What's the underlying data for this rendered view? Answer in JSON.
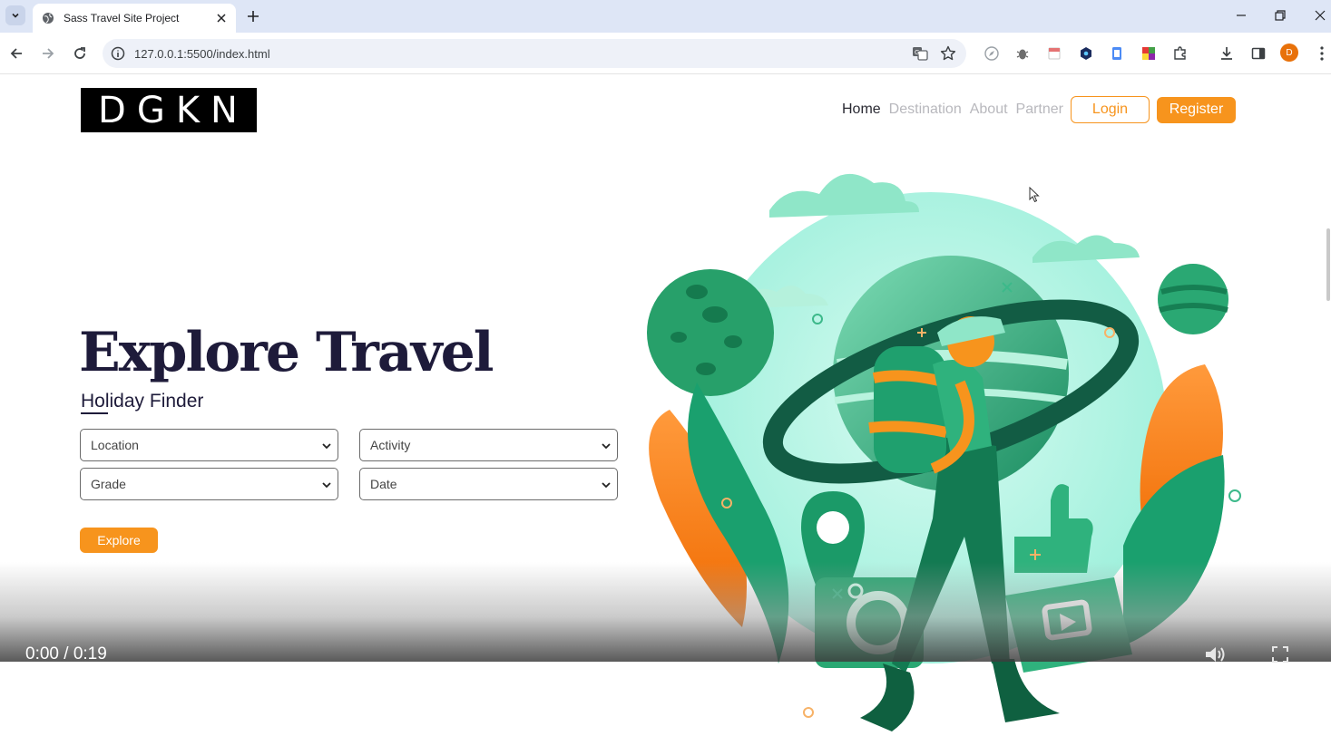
{
  "browser": {
    "tab_title": "Sass Travel Site Project",
    "url": "127.0.0.1:5500/index.html",
    "profile_initial": "D"
  },
  "brand": {
    "logo_text": "DGKN"
  },
  "nav": {
    "links": [
      "Home",
      "Destination",
      "About",
      "Partner"
    ],
    "login": "Login",
    "register": "Register"
  },
  "hero": {
    "title": "Explore Travel",
    "subtitle": "Holiday Finder"
  },
  "filters": {
    "location": "Location",
    "activity": "Activity",
    "grade": "Grade",
    "date": "Date"
  },
  "explore_button": "Explore",
  "video": {
    "time": "0:00 / 0:19"
  },
  "colors": {
    "accent": "#f7941d",
    "heading": "#1e1b3a",
    "green": "#1aa06e"
  },
  "icons": [
    "tab-menu-icon",
    "globe-icon",
    "close-icon",
    "plus-icon",
    "minimize-icon",
    "restore-icon",
    "back-icon",
    "forward-icon",
    "reload-icon",
    "info-icon",
    "translate-icon",
    "star-icon",
    "download-icon",
    "sidepanel-icon",
    "more-icon",
    "volume-icon",
    "fullscreen-icon"
  ]
}
